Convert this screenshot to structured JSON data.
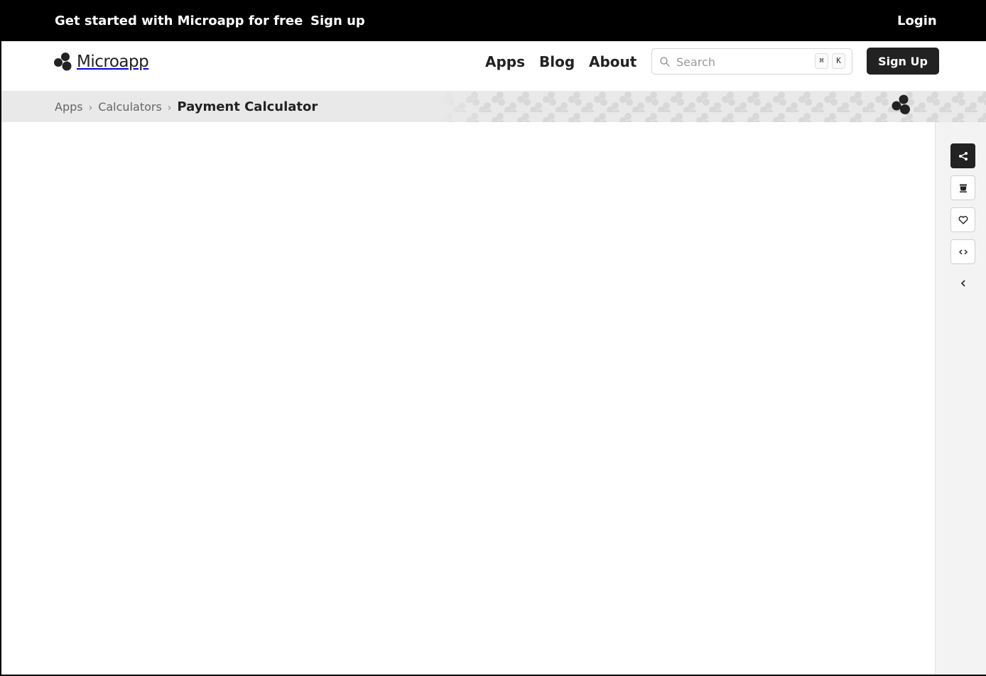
{
  "banner": {
    "promo": "Get started with Microapp for free",
    "signup": "Sign up",
    "login": "Login"
  },
  "header": {
    "logo_text": "Microapp",
    "nav": [
      "Apps",
      "Blog",
      "About"
    ],
    "search_placeholder": "Search",
    "shortcut_keys": [
      "⌘",
      "K"
    ],
    "signup_button": "Sign Up"
  },
  "breadcrumb": {
    "items": [
      "Apps",
      "Calculators"
    ],
    "current": "Payment Calculator"
  },
  "rail": {
    "buttons": [
      "share-icon",
      "coffee-icon",
      "heart-icon",
      "code-icon"
    ],
    "collapse": "chevron-left-icon"
  },
  "colors": {
    "banner_bg": "#000000",
    "button_dark": "#222222",
    "crumb_bg": "#e9e9e9"
  }
}
